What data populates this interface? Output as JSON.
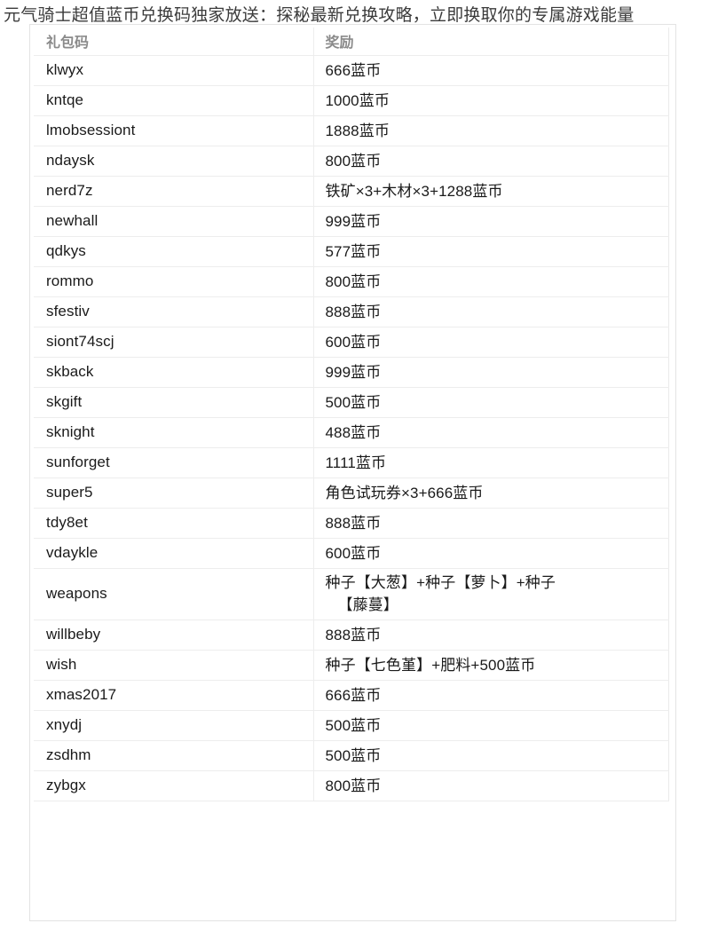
{
  "article": {
    "title": "元气骑士超值蓝币兑换码独家放送：探秘最新兑换攻略，立即换取你的专属游戏能量"
  },
  "table": {
    "columns": {
      "code": "礼包码",
      "award": "奖励"
    },
    "rows": [
      {
        "code": "klwyx",
        "award": "666蓝币"
      },
      {
        "code": "kntqe",
        "award": "1000蓝币"
      },
      {
        "code": "lmobsessiont",
        "award": "1888蓝币"
      },
      {
        "code": "ndaysk",
        "award": "800蓝币"
      },
      {
        "code": "nerd7z",
        "award": "铁矿×3+木材×3+1288蓝币"
      },
      {
        "code": "newhall",
        "award": "999蓝币"
      },
      {
        "code": "qdkys",
        "award": "577蓝币"
      },
      {
        "code": "rommo",
        "award": "800蓝币"
      },
      {
        "code": "sfestiv",
        "award": "888蓝币"
      },
      {
        "code": "siont74scj",
        "award": "600蓝币"
      },
      {
        "code": "skback",
        "award": "999蓝币"
      },
      {
        "code": "skgift",
        "award": "500蓝币"
      },
      {
        "code": "sknight",
        "award": "488蓝币"
      },
      {
        "code": "sunforget",
        "award": "1111蓝币"
      },
      {
        "code": "super5",
        "award": "角色试玩券×3+666蓝币"
      },
      {
        "code": "tdy8et",
        "award": "888蓝币"
      },
      {
        "code": "vdaykle",
        "award": "600蓝币"
      },
      {
        "code": "weapons",
        "award": "种子【大葱】+种子【萝卜】+种子【藤蔓】",
        "award_line1": "种子【大葱】+种子【萝卜】+种子",
        "award_line2": "【藤蔓】",
        "tall": true
      },
      {
        "code": "willbeby",
        "award": "888蓝币"
      },
      {
        "code": "wish",
        "award": "种子【七色堇】+肥料+500蓝币"
      },
      {
        "code": "xmas2017",
        "award": "666蓝币"
      },
      {
        "code": "xnydj",
        "award": "500蓝币"
      },
      {
        "code": "zsdhm",
        "award": "500蓝币"
      },
      {
        "code": "zybgx",
        "award": "800蓝币"
      }
    ]
  },
  "colors": {
    "title_text": "#3b3b3b",
    "header_text": "#8a8a8a",
    "body_text": "#1a1a1a",
    "row_border": "#ededed",
    "card_border": "#e3e3e3",
    "background": "#ffffff"
  }
}
